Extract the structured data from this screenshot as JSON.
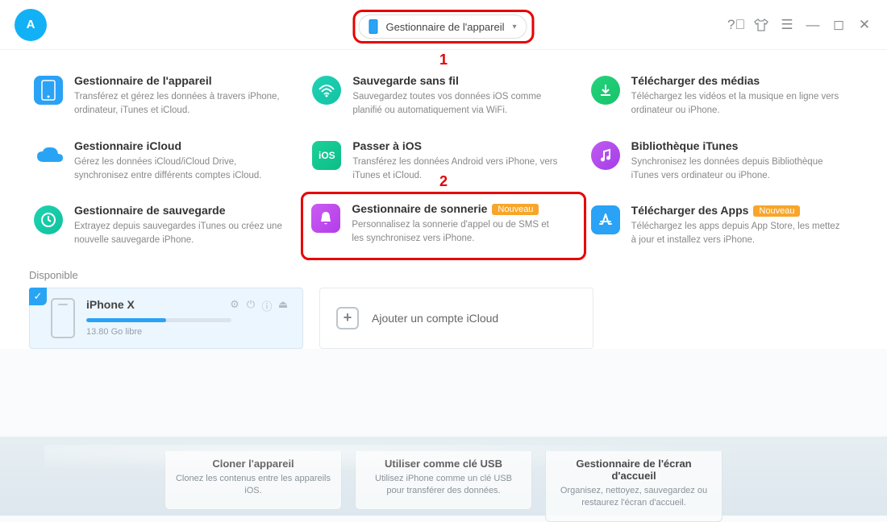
{
  "titlebar": {
    "dropdown_label": "Gestionnaire de l'appareil",
    "callout1": "1"
  },
  "tiles": [
    {
      "title": "Gestionnaire de l'appareil",
      "desc": "Transférez et gérez les données à travers iPhone, ordinateur, iTunes et iCloud."
    },
    {
      "title": "Sauvegarde sans fil",
      "desc": "Sauvegardez toutes vos données iOS comme planifié ou automatiquement via WiFi."
    },
    {
      "title": "Télécharger des médias",
      "desc": "Téléchargez les vidéos et la musique en ligne vers ordinateur ou iPhone."
    },
    {
      "title": "Gestionnaire iCloud",
      "desc": "Gérez les données iCloud/iCloud Drive, synchronisez entre différents comptes iCloud."
    },
    {
      "title": "Passer à iOS",
      "desc": "Transférez les données Android vers iPhone, vers iTunes et iCloud."
    },
    {
      "title": "Bibliothèque iTunes",
      "desc": "Synchronisez les données depuis Bibliothèque iTunes vers ordinateur ou iPhone."
    },
    {
      "title": "Gestionnaire de sauvegarde",
      "desc": "Extrayez depuis sauvegardes iTunes ou créez une nouvelle sauvegarde iPhone."
    },
    {
      "title": "Gestionnaire de sonnerie",
      "desc": "Personnalisez la sonnerie d'appel ou de SMS et les synchronisez vers iPhone.",
      "badge": "Nouveau"
    },
    {
      "title": "Télécharger des Apps",
      "desc": "Téléchargez les apps depuis App Store, les mettez à jour et installez vers iPhone.",
      "badge": "Nouveau"
    }
  ],
  "callout2": "2",
  "devices": {
    "section_label": "Disponible",
    "name": "iPhone X",
    "free": "13.80 Go libre",
    "bar_pct": 55,
    "add_label": "Ajouter un compte iCloud"
  },
  "footer": [
    {
      "title": "Cloner l'appareil",
      "desc": "Clonez les contenus entre les appareils iOS."
    },
    {
      "title": "Utiliser comme clé USB",
      "desc": "Utilisez iPhone comme un clé USB pour transférer des données."
    },
    {
      "title": "Gestionnaire de l'écran d'accueil",
      "desc": "Organisez, nettoyez, sauvegardez ou restaurez l'écran d'accueil."
    }
  ]
}
